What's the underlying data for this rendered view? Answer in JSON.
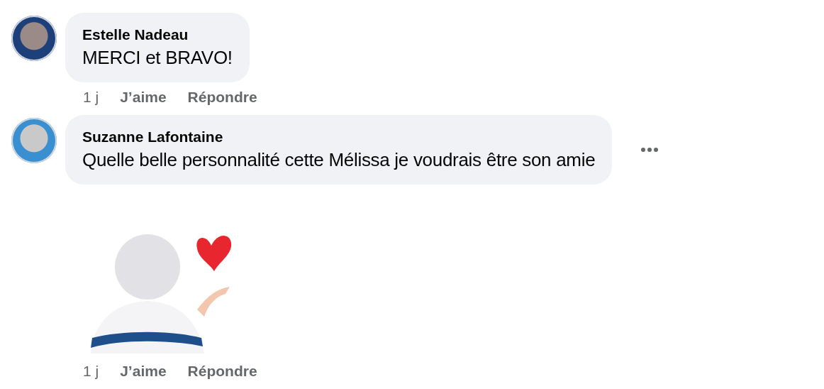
{
  "comments": [
    {
      "author": "Estelle Nadeau",
      "text": "MERCI et BRAVO!",
      "options_menu": false,
      "actions": {
        "time": "1 j",
        "like": "J’aime",
        "reply": "Répondre"
      }
    },
    {
      "author": "Suzanne Lafontaine",
      "text": "Quelle belle personnalité cette Mélissa je voudrais être son amie",
      "options_menu": true,
      "attachment": {
        "kind": "sticker"
      },
      "actions": {
        "time": "1 j",
        "like": "J’aime",
        "reply": "Répondre"
      }
    }
  ]
}
